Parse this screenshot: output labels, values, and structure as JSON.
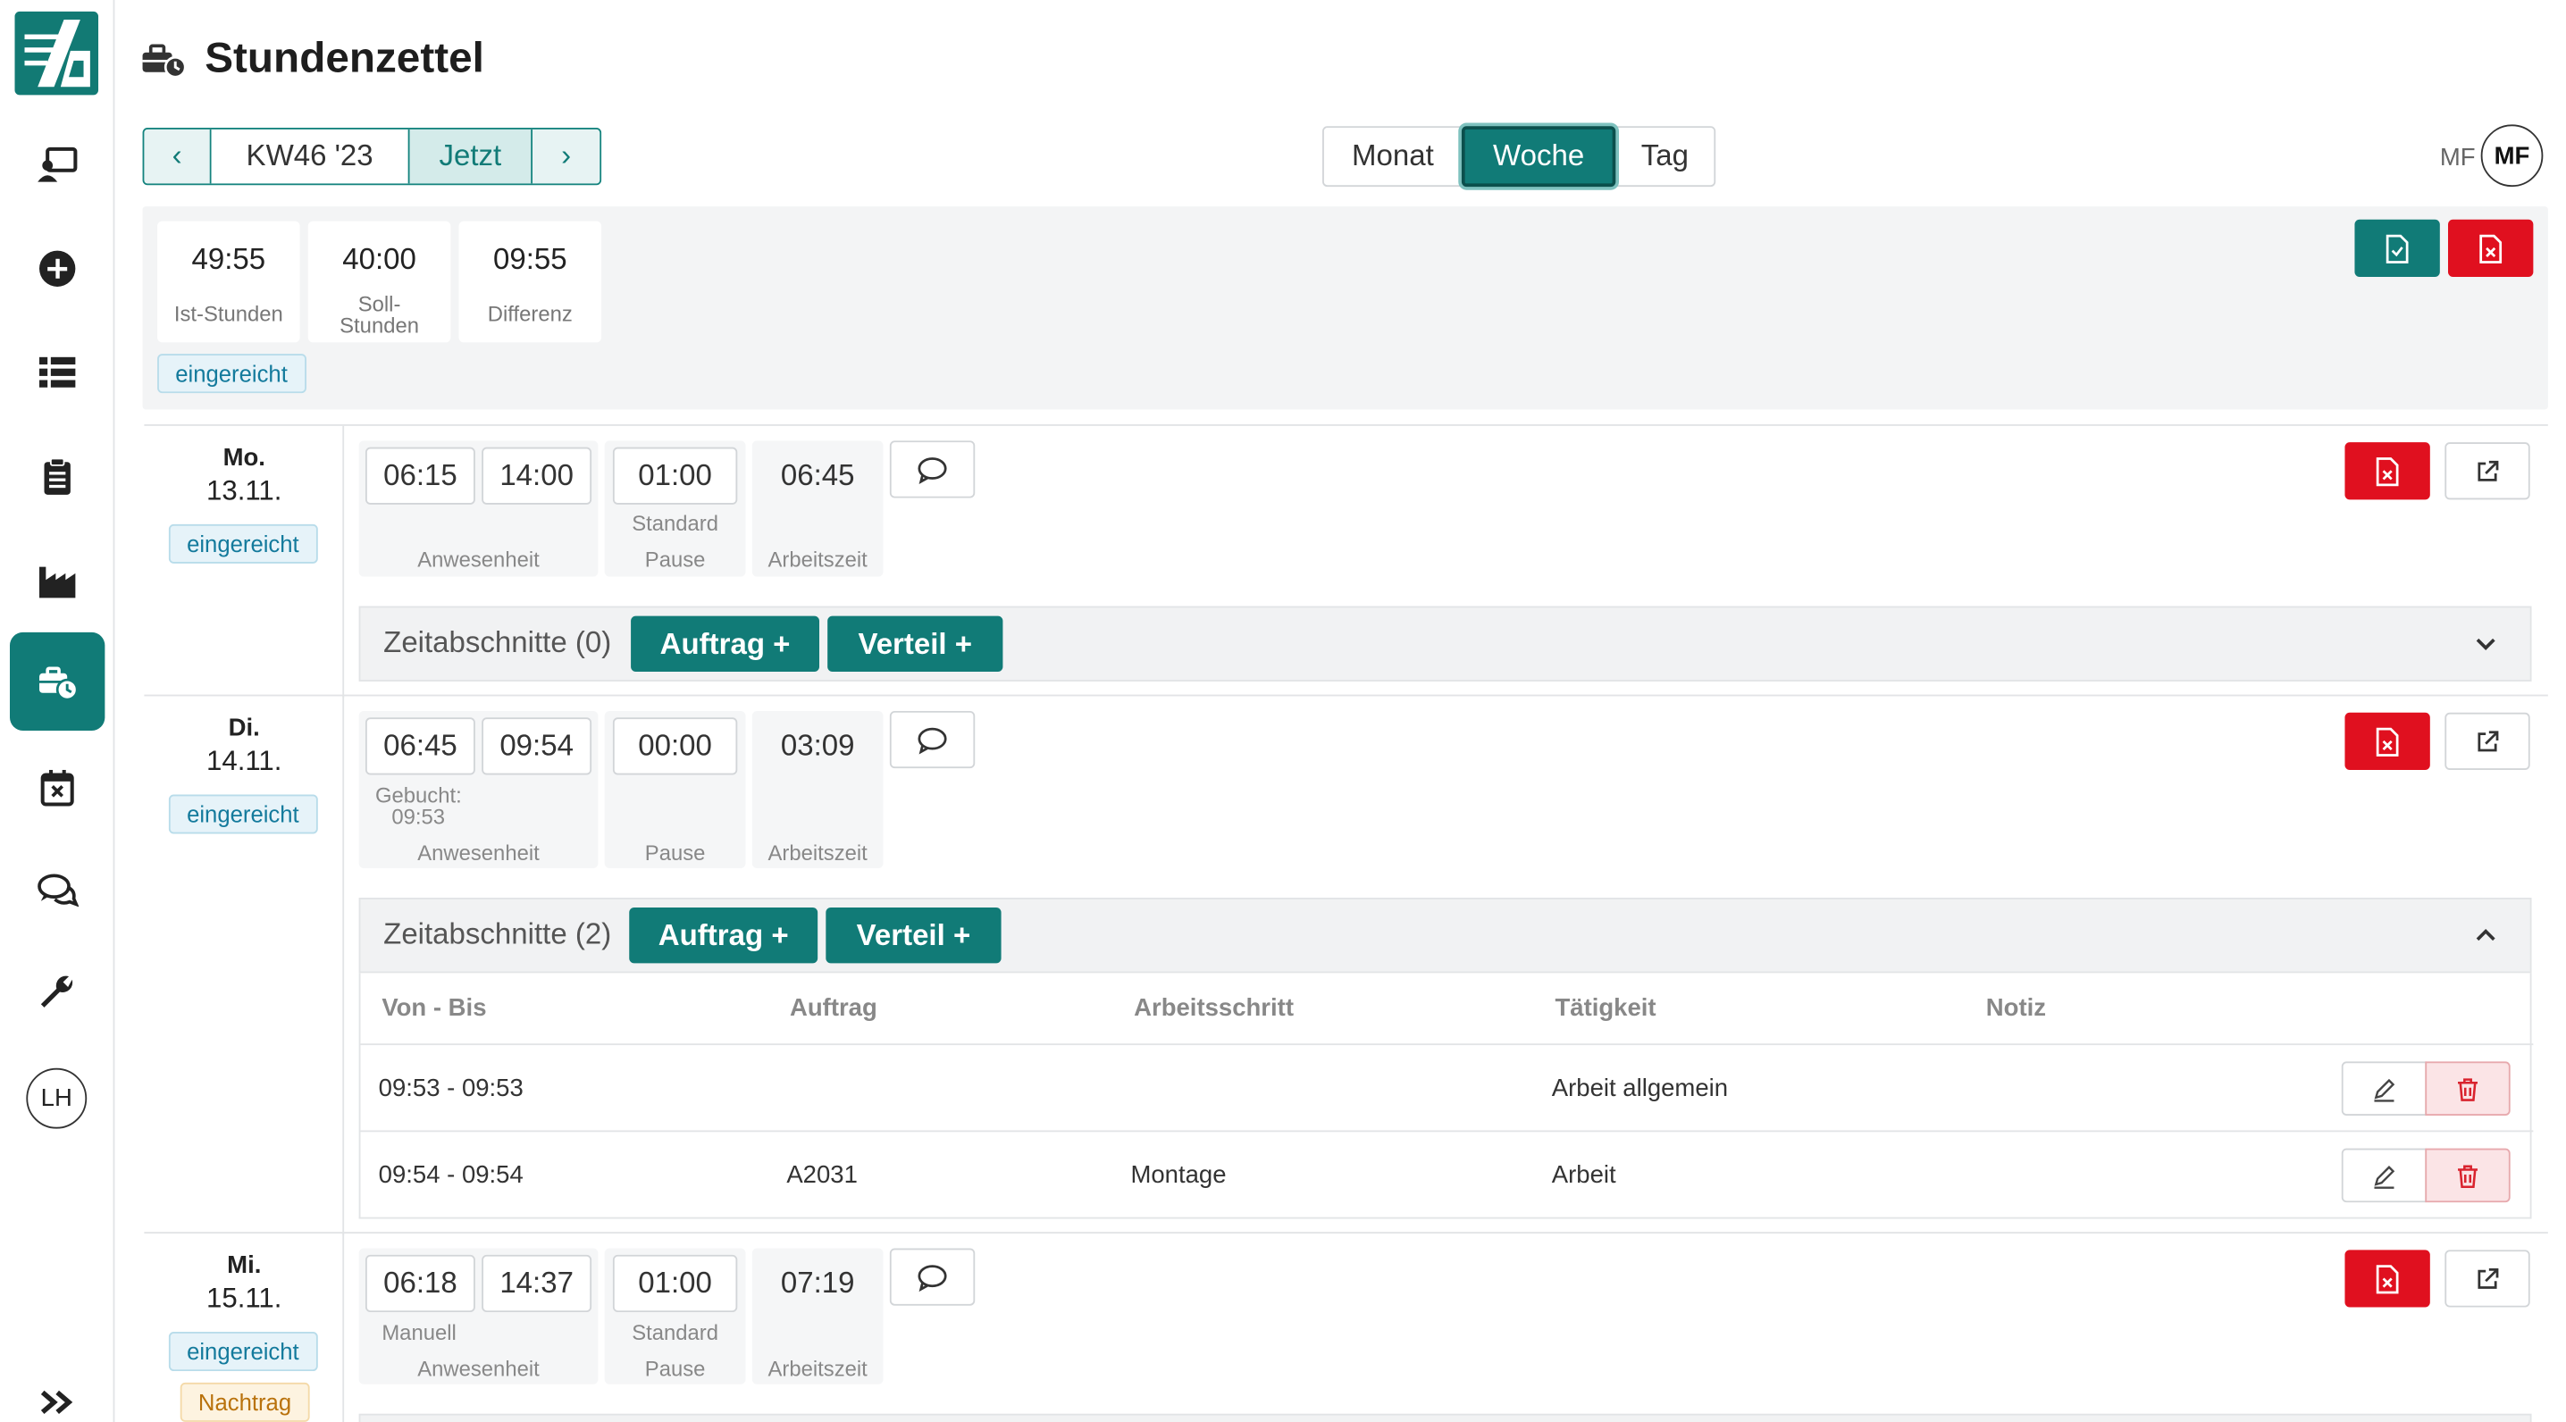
{
  "page": {
    "title": "Stundenzettel"
  },
  "sidebar": {
    "items": [
      {
        "icon": "terminal-user-icon"
      },
      {
        "icon": "plus-circle-icon"
      },
      {
        "icon": "list-icon"
      },
      {
        "icon": "clipboard-icon"
      },
      {
        "icon": "factory-icon"
      },
      {
        "icon": "timesheet-icon",
        "active": true
      },
      {
        "icon": "calendar-x-icon"
      },
      {
        "icon": "chat-icon"
      },
      {
        "icon": "wrench-icon"
      }
    ],
    "user_initials": "LH"
  },
  "nav": {
    "prev": "‹",
    "week_label": "KW46 '23",
    "now_label": "Jetzt",
    "next": "›",
    "views": {
      "month": "Monat",
      "week": "Woche",
      "day": "Tag"
    },
    "active_view": "Woche"
  },
  "user": {
    "initials_text": "MF",
    "avatar": "MF"
  },
  "summary": {
    "ist": {
      "value": "49:55",
      "label": "Ist-Stunden"
    },
    "soll": {
      "value": "40:00",
      "label_line1": "Soll-",
      "label_line2": "Stunden"
    },
    "diff": {
      "value": "09:55",
      "label": "Differenz"
    },
    "status": "eingereicht"
  },
  "labels": {
    "anwesenheit": "Anwesenheit",
    "standard": "Standard",
    "pause": "Pause",
    "arbeitszeit": "Arbeitszeit",
    "auftrag_btn": "Auftrag +",
    "verteil_btn": "Verteil +",
    "col_von_bis": "Von - Bis",
    "col_auftrag": "Auftrag",
    "col_arbeitsschritt": "Arbeitsschritt",
    "col_taetigkeit": "Tätigkeit",
    "col_notiz": "Notiz"
  },
  "days": [
    {
      "name": "Mo.",
      "date": "13.11.",
      "status": "eingereicht",
      "start": "06:15",
      "end": "14:00",
      "pause": "01:00",
      "pause_note": "Standard",
      "work": "06:45",
      "zeitabschnitte": "Zeitabschnitte (0)",
      "expanded": false
    },
    {
      "name": "Di.",
      "date": "14.11.",
      "status": "eingereicht",
      "start": "06:45",
      "end": "09:54",
      "booked_label": "Gebucht:",
      "booked_value": "09:53",
      "pause": "00:00",
      "work": "03:09",
      "zeitabschnitte": "Zeitabschnitte (2)",
      "expanded": true,
      "rows": [
        {
          "von_bis": "09:53 - 09:53",
          "auftrag": "",
          "arbeitsschritt": "",
          "taetigkeit": "Arbeit allgemein",
          "notiz": ""
        },
        {
          "von_bis": "09:54 - 09:54",
          "auftrag": "A2031",
          "arbeitsschritt": "Montage",
          "taetigkeit": "Arbeit",
          "notiz": ""
        }
      ]
    },
    {
      "name": "Mi.",
      "date": "15.11.",
      "status": "eingereicht",
      "status2": "Nachtrag",
      "start": "06:18",
      "end": "14:37",
      "start_note": "Manuell",
      "pause": "01:00",
      "pause_note": "Standard",
      "work": "07:19"
    }
  ]
}
